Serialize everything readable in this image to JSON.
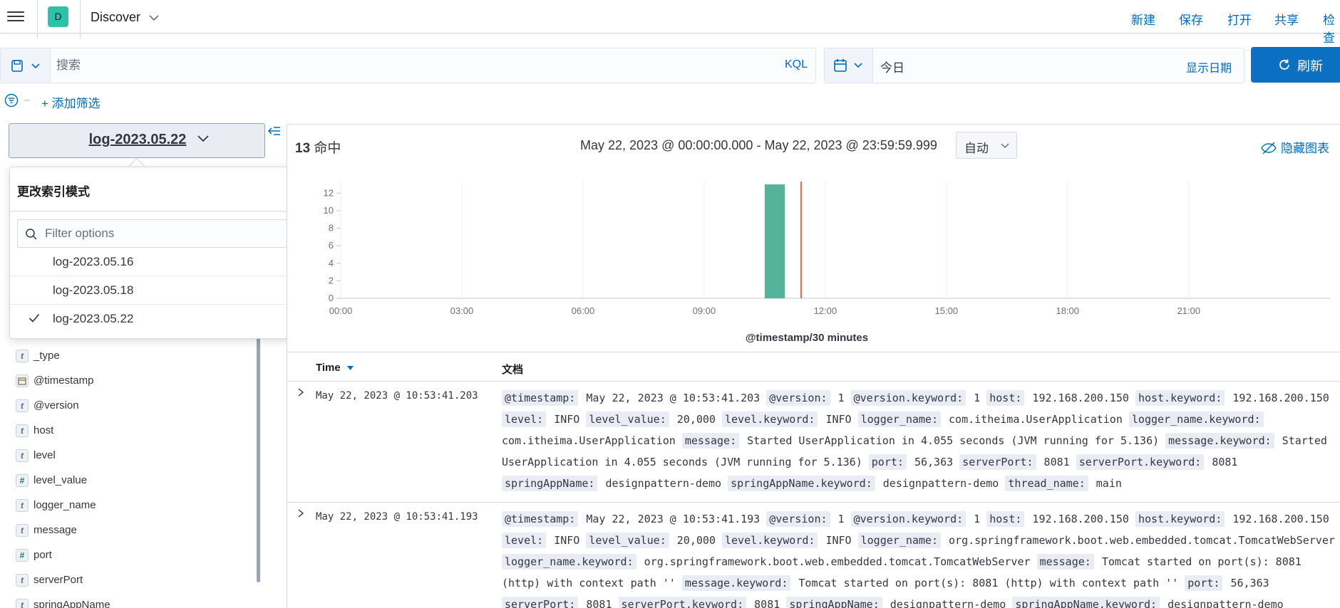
{
  "header": {
    "app_title": "Discover",
    "avatar_letter": "D",
    "links": [
      "新建",
      "保存",
      "打开",
      "共享",
      "检查"
    ]
  },
  "query": {
    "placeholder": "搜索",
    "language": "KQL"
  },
  "time": {
    "value": "今日",
    "show_dates": "显示日期",
    "refresh": "刷新"
  },
  "filter": {
    "add_label": "+ 添加筛选"
  },
  "index": {
    "current": "log-2023.05.22"
  },
  "index_popover": {
    "title": "更改索引模式",
    "filter_placeholder": "Filter options",
    "options": [
      {
        "label": "log-2023.05.16",
        "selected": false
      },
      {
        "label": "log-2023.05.18",
        "selected": false
      },
      {
        "label": "log-2023.05.22",
        "selected": true
      }
    ]
  },
  "fields": [
    {
      "type": "t",
      "name": "_type"
    },
    {
      "type": "date",
      "name": "@timestamp"
    },
    {
      "type": "t",
      "name": "@version"
    },
    {
      "type": "t",
      "name": "host"
    },
    {
      "type": "t",
      "name": "level"
    },
    {
      "type": "#",
      "name": "level_value"
    },
    {
      "type": "t",
      "name": "logger_name"
    },
    {
      "type": "t",
      "name": "message"
    },
    {
      "type": "#",
      "name": "port"
    },
    {
      "type": "t",
      "name": "serverPort"
    },
    {
      "type": "t",
      "name": "springAppName"
    }
  ],
  "summary": {
    "hits_count": "13",
    "hits_label": "命中",
    "range": "May 22, 2023 @ 00:00:00.000 - May 22, 2023 @ 23:59:59.999",
    "interval": "自动",
    "hide_chart": "隐藏图表"
  },
  "colors": {
    "accent": "#006bb8",
    "bar": "#54b399",
    "now_line": "#e7664c",
    "refresh_bg": "#0b6fc2"
  },
  "chart_data": {
    "type": "bar",
    "title": "",
    "xlabel": "@timestamp/30 minutes",
    "ylabel": "",
    "x_unit": "hours",
    "xlim": [
      0,
      24.5
    ],
    "ylim": [
      0,
      13
    ],
    "yticks": [
      0,
      2,
      4,
      6,
      8,
      10,
      12
    ],
    "xtick_labels": [
      "00:00",
      "03:00",
      "06:00",
      "09:00",
      "12:00",
      "15:00",
      "18:00",
      "21:00"
    ],
    "xtick_values": [
      0,
      3,
      6,
      9,
      12,
      15,
      18,
      21
    ],
    "bars": [
      {
        "x": 10.5,
        "width": 0.5,
        "value": 13
      }
    ],
    "now_marker": 11.4,
    "grid": true
  },
  "table": {
    "col_time": "Time",
    "col_doc": "文档",
    "rows": [
      {
        "time": "May 22, 2023 @ 10:53:41.203",
        "fields": [
          [
            "@timestamp:",
            "May 22, 2023 @ 10:53:41.203"
          ],
          [
            "@version:",
            "1"
          ],
          [
            "@version.keyword:",
            "1"
          ],
          [
            "host:",
            "192.168.200.150"
          ],
          [
            "host.keyword:",
            "192.168.200.150"
          ],
          [
            "level:",
            "INFO"
          ],
          [
            "level_value:",
            "20,000"
          ],
          [
            "level.keyword:",
            "INFO"
          ],
          [
            "logger_name:",
            "com.itheima.UserApplication"
          ],
          [
            "logger_name.keyword:",
            "com.itheima.UserApplication"
          ],
          [
            "message:",
            "Started UserApplication in 4.055 seconds (JVM running for 5.136)"
          ],
          [
            "message.keyword:",
            "Started UserApplication in 4.055 seconds (JVM running for 5.136)"
          ],
          [
            "port:",
            "56,363"
          ],
          [
            "serverPort:",
            "8081"
          ],
          [
            "serverPort.keyword:",
            "8081"
          ],
          [
            "springAppName:",
            "designpattern-demo"
          ],
          [
            "springAppName.keyword:",
            "designpattern-demo"
          ],
          [
            "thread_name:",
            "main"
          ]
        ]
      },
      {
        "time": "May 22, 2023 @ 10:53:41.193",
        "fields": [
          [
            "@timestamp:",
            "May 22, 2023 @ 10:53:41.193"
          ],
          [
            "@version:",
            "1"
          ],
          [
            "@version.keyword:",
            "1"
          ],
          [
            "host:",
            "192.168.200.150"
          ],
          [
            "host.keyword:",
            "192.168.200.150"
          ],
          [
            "level:",
            "INFO"
          ],
          [
            "level_value:",
            "20,000"
          ],
          [
            "level.keyword:",
            "INFO"
          ],
          [
            "logger_name:",
            "org.springframework.boot.web.embedded.tomcat.TomcatWebServer"
          ],
          [
            "logger_name.keyword:",
            "org.springframework.boot.web.embedded.tomcat.TomcatWebServer"
          ],
          [
            "message:",
            "Tomcat started on port(s): 8081 (http) with context path ''"
          ],
          [
            "message.keyword:",
            "Tomcat started on port(s): 8081 (http) with context path ''"
          ],
          [
            "port:",
            "56,363"
          ],
          [
            "serverPort:",
            "8081"
          ],
          [
            "serverPort.keyword:",
            "8081"
          ],
          [
            "springAppName:",
            "designpattern-demo"
          ],
          [
            "springAppName.keyword:",
            "designpattern-demo"
          ]
        ]
      }
    ]
  }
}
